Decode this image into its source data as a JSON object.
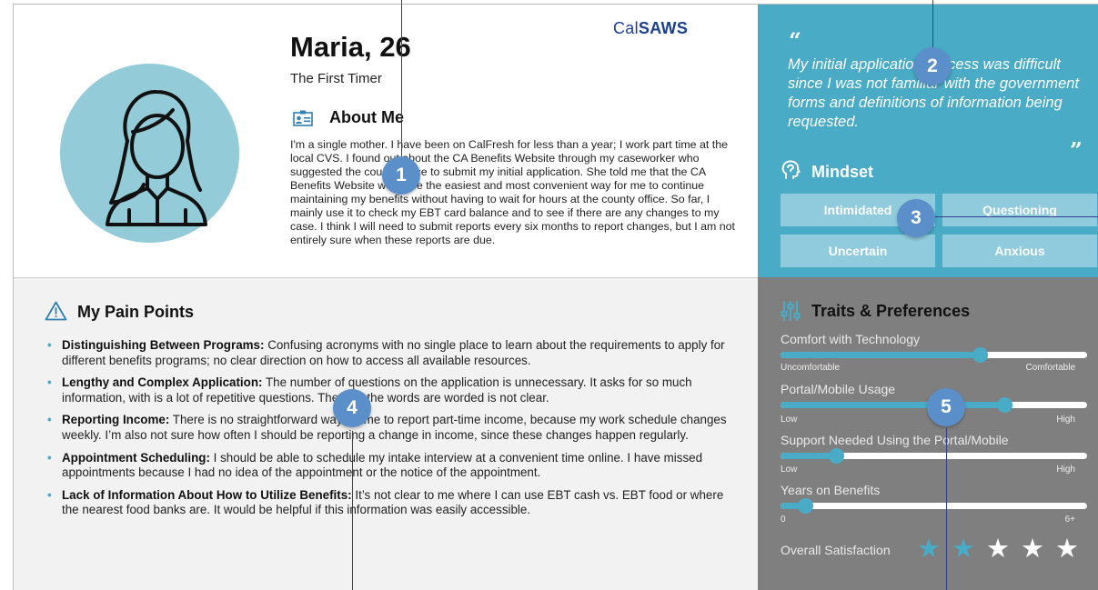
{
  "persona": {
    "name": "Maria, 26",
    "subtitle": "The First Timer",
    "logo_prefix": "Cal",
    "logo_suffix": "SAWS",
    "avatar_icon": "woman-avatar-icon"
  },
  "about": {
    "title": "About Me",
    "icon": "id-card-icon",
    "text": "I'm a single mother. I have been on CalFresh for less than a year; I work part time at the local CVS. I found out about the CA Benefits Website through my caseworker who suggested the county office to submit my initial application. She told me that the CA Benefits Website would be the easiest and most convenient way for me to continue maintaining my benefits without having to wait for hours at the county office. So far, I mainly use it to check my EBT card balance and to see if there are any changes to my case. I think I will need to submit reports every six months to report changes, but I am not entirely sure when these reports are due."
  },
  "quote": {
    "open": "“",
    "text": "My initial application process was difficult since I was not familiar with the government forms and definitions of information being requested.",
    "close": "”"
  },
  "mindset": {
    "title": "Mindset",
    "icon": "head-icon",
    "tags": [
      "Intimidated",
      "Questioning",
      "Uncertain",
      "Anxious"
    ]
  },
  "pain_points": {
    "title": "My Pain Points",
    "icon": "warning-icon",
    "items": [
      {
        "heading": "Distinguishing Between Programs:",
        "text": " Confusing acronyms with no single place to learn about the requirements to apply for different benefits programs; no clear direction on how to access all available resources."
      },
      {
        "heading": "Lengthy and Complex Application:",
        "text": " The number of questions on the application is unnecessary. It asks for so much information, with is a lot of repetitive questions. The way the words are worded is not clear."
      },
      {
        "heading": "Reporting Income:",
        "text": " There is no straightforward way for me to report part-time income, because my work schedule changes weekly. I’m also not sure how often I should be reporting a change in income, since these changes happen regularly."
      },
      {
        "heading": "Appointment Scheduling:",
        "text": " I should be able to schedule my intake interview at a convenient time online. I have missed appointments because I had no idea of the appointment or the notice of the appointment."
      },
      {
        "heading": "Lack of Information About How to Utilize Benefits:",
        "text": " It’s not clear to me where I can use EBT cash vs. EBT food or where the nearest food banks are. It would be helpful if this information was easily accessible."
      }
    ]
  },
  "traits": {
    "title": "Traits & Preferences",
    "icon": "sliders-icon",
    "sliders": [
      {
        "label": "Comfort with Technology",
        "min": "Uncomfortable",
        "max": "Comfortable",
        "value": 0.65
      },
      {
        "label": "Portal/Mobile Usage",
        "min": "Low",
        "max": "High",
        "value": 0.73
      },
      {
        "label": "Support Needed Using the Portal/Mobile",
        "min": "Low",
        "max": "High",
        "value": 0.18
      },
      {
        "label": "Years on Benefits",
        "min": "0",
        "max": "6+",
        "value": 0.08
      }
    ],
    "satisfaction_label": "Overall Satisfaction",
    "satisfaction_rating": 2,
    "satisfaction_max": 5,
    "star_filled_color": "#49abc5",
    "star_empty_color": "#ffffff"
  },
  "annotations": [
    "1",
    "2",
    "3",
    "4",
    "5"
  ],
  "colors": {
    "teal": "#49abc5",
    "light_teal": "#93cbd9",
    "gray_panel": "#7f7f7f",
    "marker_blue": "#5a8fc9",
    "line_navy": "#2e3f8c"
  }
}
